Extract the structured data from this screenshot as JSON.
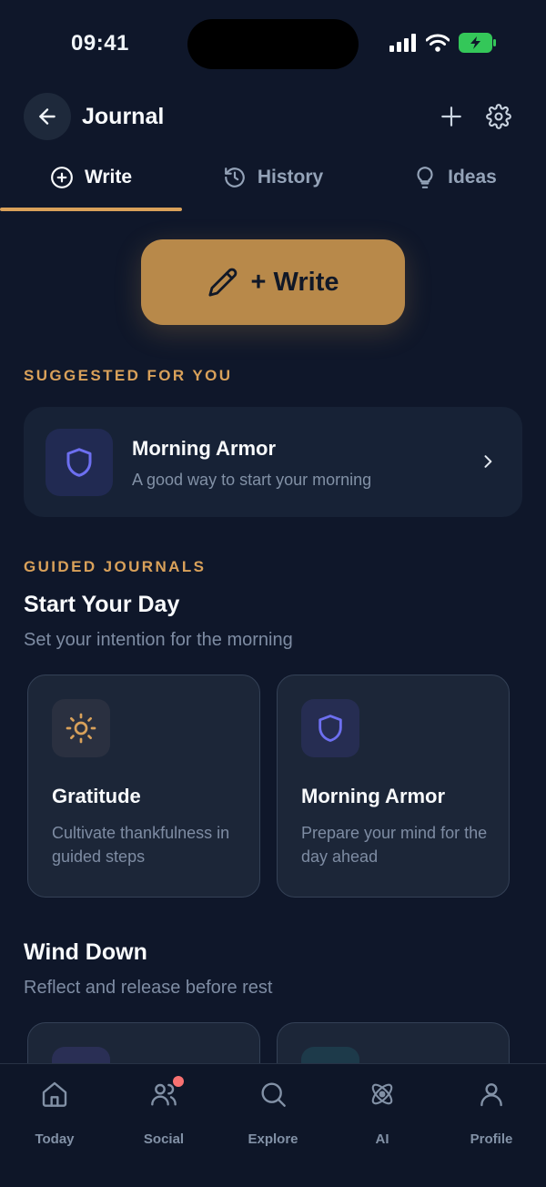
{
  "status": {
    "time": "09:41"
  },
  "header": {
    "title": "Journal"
  },
  "tabs": [
    {
      "label": "Write",
      "icon": "plus-circle-icon",
      "active": true
    },
    {
      "label": "History",
      "icon": "history-icon",
      "active": false
    },
    {
      "label": "Ideas",
      "icon": "lightbulb-icon",
      "active": false
    }
  ],
  "write_button": {
    "label": "+ Write",
    "icon": "pencil-icon"
  },
  "suggested": {
    "section_label": "SUGGESTED FOR YOU",
    "title": "Morning Armor",
    "subtitle": "A good way to start your morning",
    "icon": "shield-icon"
  },
  "guided": {
    "section_label": "GUIDED JOURNALS",
    "start_day": {
      "title": "Start Your Day",
      "subtitle": "Set your intention for the morning",
      "cards": [
        {
          "title": "Gratitude",
          "description": "Cultivate thankfulness in guided steps",
          "icon": "sun-icon"
        },
        {
          "title": "Morning Armor",
          "description": "Prepare your mind for the day ahead",
          "icon": "shield-icon"
        }
      ]
    },
    "wind_down": {
      "title": "Wind Down",
      "subtitle": "Reflect and release before rest"
    }
  },
  "nav": [
    {
      "label": "Today",
      "icon": "home-icon"
    },
    {
      "label": "Social",
      "icon": "users-icon",
      "badge": true
    },
    {
      "label": "Explore",
      "icon": "search-icon"
    },
    {
      "label": "AI",
      "icon": "atom-icon"
    },
    {
      "label": "Profile",
      "icon": "user-icon"
    }
  ],
  "colors": {
    "background": "#0f172a",
    "accent": "#d9a15a",
    "write_button": "#b8894a",
    "card": "#1c2638",
    "shield": "#6d6ff0",
    "badge": "#f87171"
  }
}
